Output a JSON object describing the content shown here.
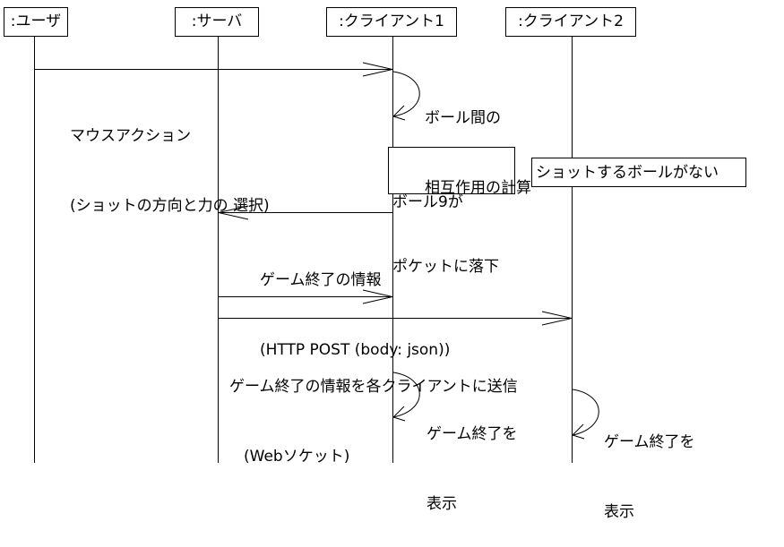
{
  "participants": {
    "user": ":ユーザ",
    "server": ":サーバ",
    "client1": ":クライアント1",
    "client2": ":クライアント2"
  },
  "messages": {
    "mouse_action": {
      "line1": "マウスアクション",
      "line2": "(ショットの方向と力の 選択)"
    },
    "interaction_calc": {
      "line1": "ボール間の",
      "line2": "相互作用の計算"
    },
    "game_end_info": {
      "line1": "ゲーム終了の情報",
      "line2": "(HTTP POST (body: json))"
    },
    "broadcast": {
      "line1": "ゲーム終了の情報を各クライアントに送信",
      "line2": "(Webソケット)"
    },
    "show_end_c1": {
      "line1": "ゲーム終了を",
      "line2": "表示"
    },
    "show_end_c2": {
      "line1": "ゲーム終了を",
      "line2": "表示"
    }
  },
  "notes": {
    "ball9": {
      "line1": "ボール9が",
      "line2": "ポケットに落下"
    },
    "no_ball": "ショットするボールがない"
  }
}
